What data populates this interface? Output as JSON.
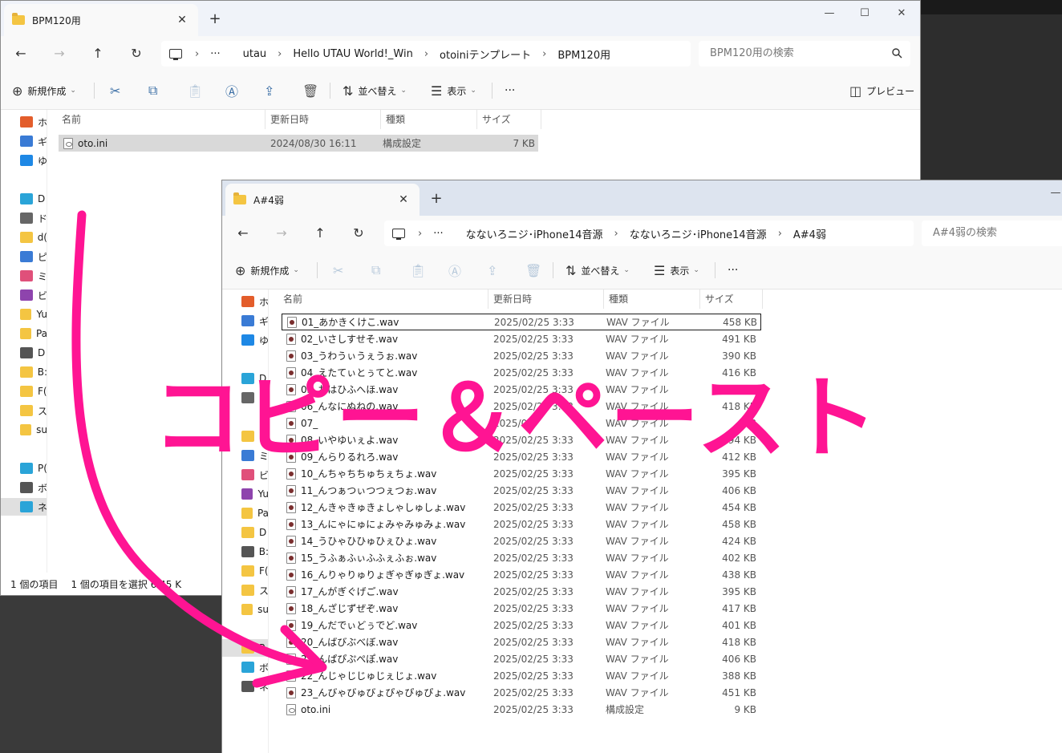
{
  "window1": {
    "tab_title": "BPM120用",
    "tab_close": "✕",
    "tab_new": "+",
    "controls": {
      "minimize": "—",
      "maximize": "☐",
      "close": "✕"
    },
    "breadcrumb": [
      "utau",
      "Hello UTAU World!_Win",
      "otoiniテンプレート",
      "BPM120用"
    ],
    "breadcrumb_more": "···",
    "search_placeholder": "BPM120用の検索",
    "toolbar": {
      "new": "新規作成",
      "sort": "並べ替え",
      "view": "表示",
      "more": "···",
      "preview": "プレビュー"
    },
    "columns": {
      "name": "名前",
      "date": "更新日時",
      "type": "種類",
      "size": "サイズ"
    },
    "files": [
      {
        "name": "oto.ini",
        "date": "2024/08/30 16:11",
        "type": "構成設定",
        "size": "7 KB"
      }
    ],
    "nav": [
      "ホ",
      "ギ",
      "ゆ",
      "D",
      "ド",
      "d(",
      "ピ",
      "ミ",
      "ビ",
      "Yu",
      "Pa",
      "D",
      "B:",
      "F(",
      "ス",
      "su",
      "P(",
      "ボ",
      "ネ"
    ],
    "status": {
      "count": "1 個の項目",
      "selected": "1 個の項目を選択  6.45 K"
    }
  },
  "window2": {
    "tab_title": "A#4弱",
    "tab_close": "✕",
    "tab_new": "+",
    "controls": {
      "minimize": "—"
    },
    "breadcrumb": [
      "なないろニジ･iPhone14音源",
      "なないろニジ･iPhone14音源",
      "A#4弱"
    ],
    "breadcrumb_more": "···",
    "search_placeholder": "A#4弱の検索",
    "toolbar": {
      "new": "新規作成",
      "sort": "並べ替え",
      "view": "表示",
      "more": "···"
    },
    "columns": {
      "name": "名前",
      "date": "更新日時",
      "type": "種類",
      "size": "サイズ"
    },
    "files": [
      {
        "name": "01_あかきくけこ.wav",
        "date": "2025/02/25 3:33",
        "type": "WAV ファイル",
        "size": "458 KB"
      },
      {
        "name": "02_いさしすせそ.wav",
        "date": "2025/02/25 3:33",
        "type": "WAV ファイル",
        "size": "491 KB"
      },
      {
        "name": "03_うわうぃうぇうぉ.wav",
        "date": "2025/02/25 3:33",
        "type": "WAV ファイル",
        "size": "390 KB"
      },
      {
        "name": "04_えたてぃとぅてと.wav",
        "date": "2025/02/25 3:33",
        "type": "WAV ファイル",
        "size": "416 KB"
      },
      {
        "name": "05_おはひふへほ.wav",
        "date": "2025/02/25 3:33",
        "type": "WAV ファイル",
        "size": "393 KB"
      },
      {
        "name": "06_んなにぬねの.wav",
        "date": "2025/02/25 3:33",
        "type": "WAV ファイル",
        "size": "418 KB"
      },
      {
        "name": "07_",
        "date": "2025/02",
        "type": "WAV ファイル",
        "size": "KB"
      },
      {
        "name": "08_いやゆいぇよ.wav",
        "date": "2025/02/25 3:33",
        "type": "WAV ファイル",
        "size": "394 KB"
      },
      {
        "name": "09_んらりるれろ.wav",
        "date": "2025/02/25 3:33",
        "type": "WAV ファイル",
        "size": "412 KB"
      },
      {
        "name": "10_んちゃちちゅちぇちょ.wav",
        "date": "2025/02/25 3:33",
        "type": "WAV ファイル",
        "size": "395 KB"
      },
      {
        "name": "11_んつぁつぃつつぇつぉ.wav",
        "date": "2025/02/25 3:33",
        "type": "WAV ファイル",
        "size": "406 KB"
      },
      {
        "name": "12_んきゃきゅきょしゃしゅしょ.wav",
        "date": "2025/02/25 3:33",
        "type": "WAV ファイル",
        "size": "454 KB"
      },
      {
        "name": "13_んにゃにゅにょみゃみゅみょ.wav",
        "date": "2025/02/25 3:33",
        "type": "WAV ファイル",
        "size": "458 KB"
      },
      {
        "name": "14_うひゃひひゅひぇひょ.wav",
        "date": "2025/02/25 3:33",
        "type": "WAV ファイル",
        "size": "424 KB"
      },
      {
        "name": "15_うふぁふぃふふぇふぉ.wav",
        "date": "2025/02/25 3:33",
        "type": "WAV ファイル",
        "size": "402 KB"
      },
      {
        "name": "16_んりゃりゅりょぎゃぎゅぎょ.wav",
        "date": "2025/02/25 3:33",
        "type": "WAV ファイル",
        "size": "438 KB"
      },
      {
        "name": "17_んがぎぐげご.wav",
        "date": "2025/02/25 3:33",
        "type": "WAV ファイル",
        "size": "395 KB"
      },
      {
        "name": "18_んざじずぜぞ.wav",
        "date": "2025/02/25 3:33",
        "type": "WAV ファイル",
        "size": "417 KB"
      },
      {
        "name": "19_んだでぃどぅでど.wav",
        "date": "2025/02/25 3:33",
        "type": "WAV ファイル",
        "size": "401 KB"
      },
      {
        "name": "20_んばびぶべぼ.wav",
        "date": "2025/02/25 3:33",
        "type": "WAV ファイル",
        "size": "418 KB"
      },
      {
        "name": "21_んぱぴぷぺぽ.wav",
        "date": "2025/02/25 3:33",
        "type": "WAV ファイル",
        "size": "406 KB"
      },
      {
        "name": "22_んじゃじじゅじぇじょ.wav",
        "date": "2025/02/25 3:33",
        "type": "WAV ファイル",
        "size": "388 KB"
      },
      {
        "name": "23_んびゃびゅびょぴゃぴゅぴょ.wav",
        "date": "2025/02/25 3:33",
        "type": "WAV ファイル",
        "size": "451 KB"
      },
      {
        "name": "oto.ini",
        "date": "2025/02/25 3:33",
        "type": "構成設定",
        "size": "9 KB"
      }
    ],
    "nav": [
      "ホ",
      "ギ",
      "ゆ",
      "D",
      "ド",
      "ピ",
      "ミ",
      "ビ",
      "Yu",
      "Pa",
      "D",
      "B:",
      "F(",
      "ス",
      "su",
      "P",
      "ボ",
      "ネ"
    ]
  },
  "overlay": {
    "text": "コピー＆ペースト",
    "color": "#ff1493"
  }
}
